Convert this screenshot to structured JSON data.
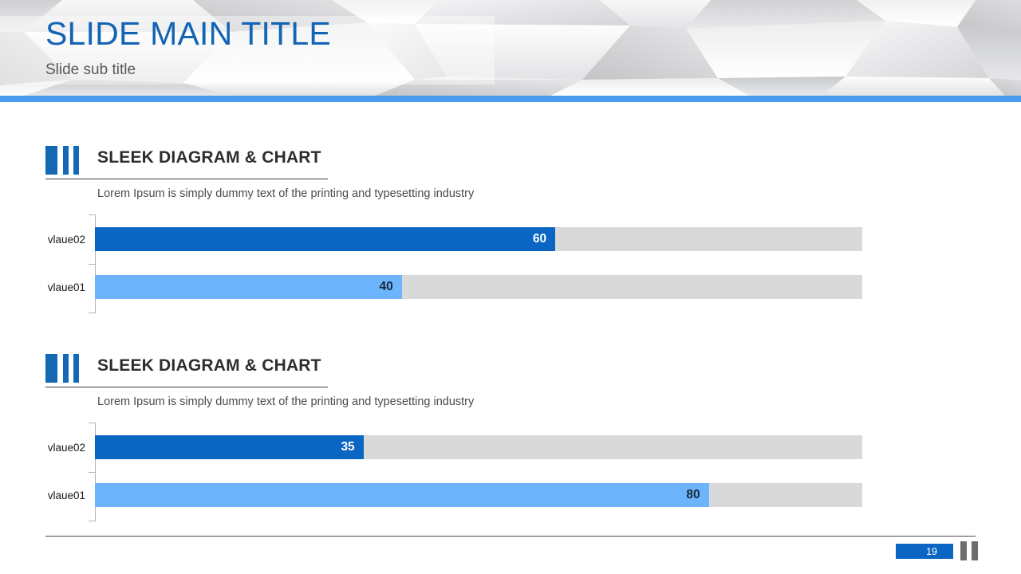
{
  "header": {
    "title": "SLIDE MAIN TITLE",
    "subtitle": "Slide sub title",
    "accent_color": "#4a9bef",
    "title_color": "#1364b5"
  },
  "sections": [
    {
      "icon": "three-bars-icon",
      "title": "SLEEK DIAGRAM & CHART",
      "description": "Lorem Ipsum is simply dummy text of the printing and typesetting industry",
      "chart_data": {
        "type": "bar",
        "orientation": "horizontal",
        "title": "SLEEK DIAGRAM & CHART",
        "subtitle": "Lorem Ipsum is simply dummy text of the printing and typesetting industry",
        "categories": [
          "vlaue02",
          "vlaue01"
        ],
        "values": [
          60,
          40
        ],
        "bar_colors": [
          "#0a66c2",
          "#6cb4fc"
        ],
        "track_color": "#d9d9d9",
        "xlabel": "",
        "ylabel": "",
        "xlim": [
          0,
          100
        ],
        "grid": false,
        "legend": "none",
        "bar_fill_percent": [
          60,
          40
        ]
      }
    },
    {
      "icon": "three-bars-icon",
      "title": "SLEEK DIAGRAM & CHART",
      "description": "Lorem Ipsum is simply dummy text of the printing and typesetting industry",
      "chart_data": {
        "type": "bar",
        "orientation": "horizontal",
        "title": "SLEEK DIAGRAM & CHART",
        "subtitle": "Lorem Ipsum is simply dummy text of the printing and typesetting industry",
        "categories": [
          "vlaue02",
          "vlaue01"
        ],
        "values": [
          35,
          80
        ],
        "bar_colors": [
          "#0a66c2",
          "#6cb4fc"
        ],
        "track_color": "#d9d9d9",
        "xlabel": "",
        "ylabel": "",
        "xlim": [
          0,
          100
        ],
        "grid": false,
        "legend": "none",
        "bar_fill_percent": [
          35,
          80
        ]
      }
    }
  ],
  "footer": {
    "page_number": "19",
    "page_box_color": "#0a66c2"
  }
}
